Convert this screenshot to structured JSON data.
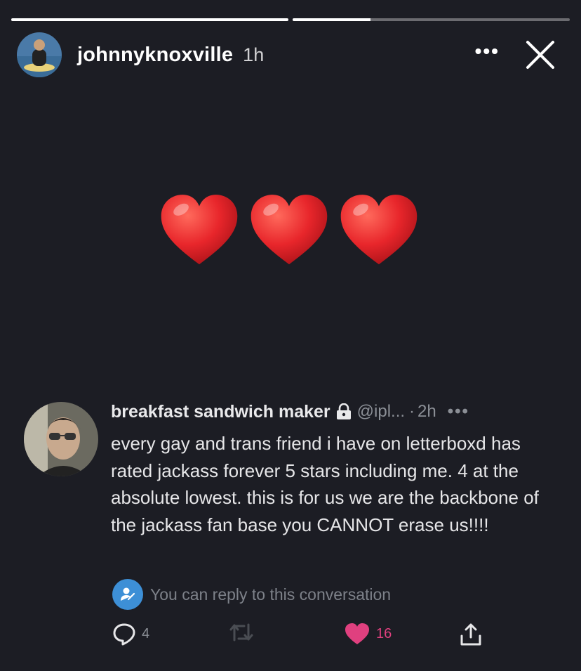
{
  "story": {
    "progress": [
      1.0,
      0.28
    ],
    "username": "johnnyknoxville",
    "time": "1h",
    "more_label": "•••"
  },
  "hearts": {
    "count": 3,
    "color": "#e8262b"
  },
  "tweet": {
    "display_name": "breakfast sandwich maker",
    "handle": "@ipl...",
    "separator": "·",
    "time": "2h",
    "more_label": "•••",
    "text": "every gay and trans friend i have on letterboxd has rated jackass forever 5 stars including me. 4 at the absolute lowest. this is for us we are the backbone of the jackass fan base you CANNOT erase us!!!!",
    "reply_notice": "You can reply to this conversation",
    "actions": {
      "replies": "4",
      "likes": "16"
    },
    "colors": {
      "accent": "#3d8fd6",
      "like": "#e0407f"
    },
    "icons": [
      "lock-icon",
      "reply-icon",
      "retweet-icon",
      "heart-icon",
      "share-icon",
      "person-reply-icon"
    ]
  }
}
